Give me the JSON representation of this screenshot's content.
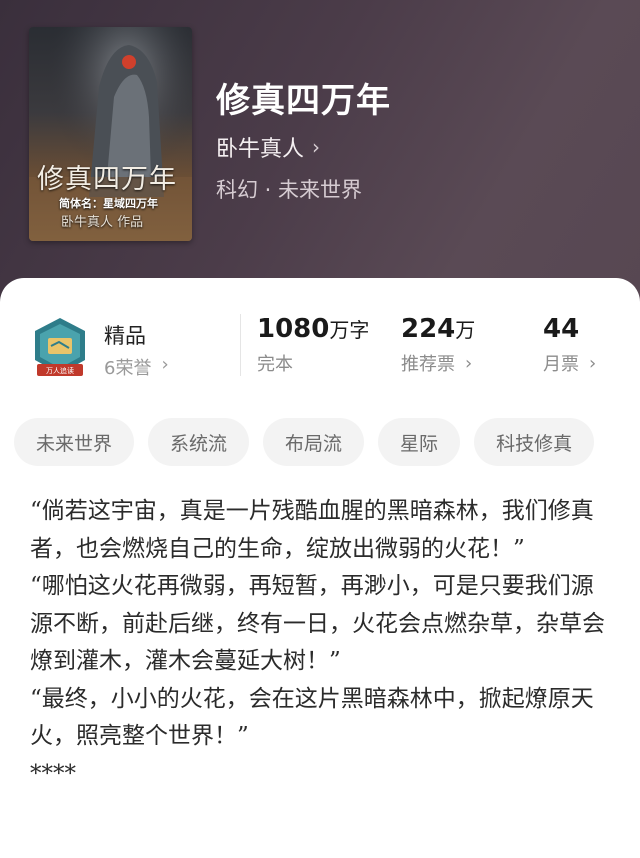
{
  "book": {
    "title": "修真四万年",
    "author": "卧牛真人",
    "genre": "科幻 · 未来世界",
    "cover": {
      "title": "修真四万年",
      "subtitle": "简体名：星域四万年",
      "author": "卧牛真人 作品"
    }
  },
  "badge": {
    "label": "精品",
    "honor": "6荣誉",
    "ribbon": "万人追读"
  },
  "stats": [
    {
      "num": "1080",
      "unit": "万字",
      "label": "完本",
      "chevron": false
    },
    {
      "num": "224",
      "unit": "万",
      "label": "推荐票",
      "chevron": true
    },
    {
      "num": "44",
      "unit": "",
      "label": "月票",
      "chevron": true
    }
  ],
  "tags": [
    "未来世界",
    "系统流",
    "布局流",
    "星际",
    "科技修真"
  ],
  "synopsis": [
    "“倘若这宇宙，真是一片残酷血腥的黑暗森林，我们修真者，也会燃烧自己的生命，绽放出微弱的火花！”",
    "“哪怕这火花再微弱，再短暂，再渺小，可是只要我们源源不断，前赴后继，终有一日，火花会点燃杂草，杂草会燎到灌木，灌木会蔓延大树！”",
    "“最终，小小的火花，会在这片黑暗森林中，掀起燎原天火，照亮整个世界！”",
    "****"
  ],
  "colors": {
    "card": "#ffffff",
    "tag_bg": "#f3f3f3",
    "header": "#4a3b47"
  }
}
